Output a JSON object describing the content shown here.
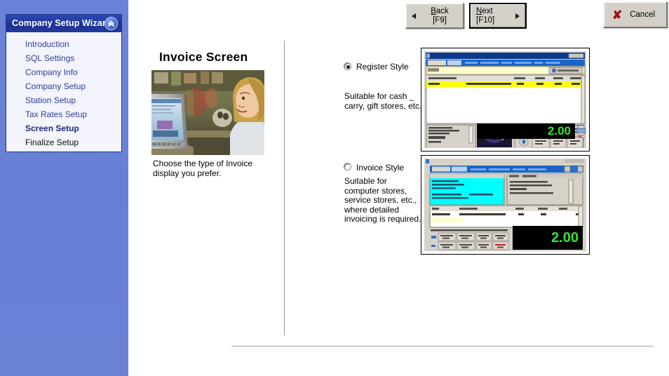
{
  "window": {
    "title": "Company Setup Wizard"
  },
  "sidebar": {
    "header_title": "Company Setup Wizard",
    "collapse_icon": "double-chevron-up-icon",
    "items": [
      {
        "label": "Introduction",
        "state": "link"
      },
      {
        "label": "SQL Settings",
        "state": "link"
      },
      {
        "label": "Company Info",
        "state": "link"
      },
      {
        "label": "Company Setup",
        "state": "link"
      },
      {
        "label": "Station Setup",
        "state": "link"
      },
      {
        "label": "Tax Rates Setup",
        "state": "link"
      },
      {
        "label": "Screen Setup",
        "state": "active"
      },
      {
        "label": "Finalize Setup",
        "state": "plain"
      }
    ]
  },
  "toolbar": {
    "back": {
      "label_line1": "Back",
      "label_line2": "[F9]",
      "accel": "B",
      "icon": "triangle-left-icon"
    },
    "next": {
      "label_line1": "Next",
      "label_line2": "[F10]",
      "accel": "N",
      "icon": "triangle-right-icon"
    },
    "cancel": {
      "label": "Cancel",
      "icon": "red-x-icon"
    }
  },
  "main": {
    "page_title": "Invoice Screen",
    "photo_alt": "woman-at-pos-terminal-photo",
    "photo_caption": "Choose the type of Invoice display you prefer.",
    "options": [
      {
        "id": "register",
        "label": "Register Style",
        "selected": true,
        "description": "Suitable for cash _ carry, gift stores, etc.",
        "preview_alt": "register-style-screen-preview",
        "preview_total": "2.00"
      },
      {
        "id": "invoice",
        "label": "Invoice Style",
        "selected": false,
        "description": "Suitable for computer stores, service stores, etc., where detailed invoicing is required.",
        "preview_alt": "invoice-style-screen-preview",
        "preview_total": "2.00"
      }
    ]
  },
  "colors": {
    "sidebar_bg": "#6780d6",
    "header_bg": "#1e3390",
    "link": "#2e3f92",
    "active_link": "#1f2b7a",
    "button_face": "#d4d0c8",
    "cancel_x": "#9c0c14",
    "total_green": "#2ee82e"
  }
}
